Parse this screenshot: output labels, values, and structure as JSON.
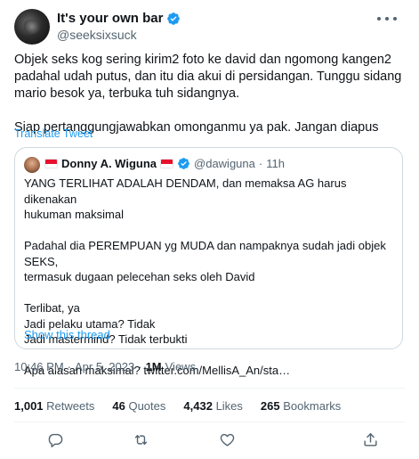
{
  "author": {
    "display_name": "It's your own bar",
    "handle": "@seeksixsuck"
  },
  "tweet": {
    "lines": [
      "Objek seks kog sering kirim2 foto ke david dan ngomong kangen2",
      "padahal udah putus, dan itu dia akui di persidangan. Tunggu sidang",
      "mario besok ya, terbuka tuh sidangnya.",
      "Siap pertanggungjawabkan omonganmu ya pak. Jangan diapus"
    ],
    "translate_label": "Translate Tweet"
  },
  "quoted": {
    "display_name": "Donny A. Wiguna",
    "handle": "@dawiguna",
    "separator": "·",
    "time": "11h",
    "lines": [
      "YANG TERLIHAT ADALAH DENDAM, dan memaksa AG harus dikenakan",
      "hukuman maksimal",
      "Padahal dia PEREMPUAN yg MUDA dan nampaknya sudah jadi objek SEKS,",
      "termasuk dugaan pelecehan seks oleh David",
      "Terlibat, ya",
      "Jadi pelaku utama? Tidak",
      "Jadi mastermind? Tidak terbukti",
      "Apa alasan maksimal? twitter.com/MellisA_An/sta…"
    ],
    "show_thread_label": "Show this thread"
  },
  "meta": {
    "time": "10:46 PM",
    "dot1": "·",
    "date": "Apr 5, 2023",
    "dot2": "·",
    "views_count": "1M",
    "views_label": "Views"
  },
  "stats": {
    "retweets_count": "1,001",
    "retweets_label": "Retweets",
    "quotes_count": "46",
    "quotes_label": "Quotes",
    "likes_count": "4,432",
    "likes_label": "Likes",
    "bookmarks_count": "265",
    "bookmarks_label": "Bookmarks"
  },
  "icons": {
    "verified": "verified-badge-icon",
    "more": "more-horizontal-icon",
    "flag": "indonesia-flag-icon",
    "reply": "reply-icon",
    "retweet": "retweet-icon",
    "like": "heart-icon",
    "share": "share-icon"
  },
  "colors": {
    "accent": "#1d9bf0",
    "text": "#0f1419",
    "secondary": "#536471",
    "border": "#cfd9de",
    "flag_red": "#e8112d",
    "flag_white": "#ffffff"
  }
}
